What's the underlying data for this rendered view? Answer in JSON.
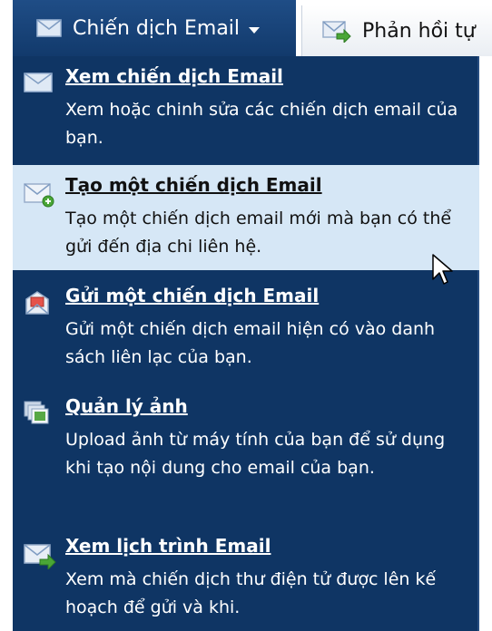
{
  "tabs": [
    {
      "label": "Chiến dịch Email",
      "icon": "envelope-icon"
    },
    {
      "label": "Phản hồi tự",
      "icon": "envelope-arrow-icon"
    }
  ],
  "menu": {
    "items": [
      {
        "title": "Xem chiến dịch Email",
        "desc": "Xem hoặc chinh sửa các chiến dịch email của bạn.",
        "icon": "envelope-icon"
      },
      {
        "title": "Tạo một chiến dịch Email",
        "desc": "Tạo một chiến dịch email mới mà bạn có thể gửi đến địa chi liên hệ.",
        "icon": "envelope-add-icon"
      },
      {
        "title": "Gửi một chiến dịch Email",
        "desc": "Gửi một chiến dịch email hiện có vào danh sách liên lạc của bạn.",
        "icon": "email-send-icon"
      },
      {
        "title": "Quản lý ảnh",
        "desc": "Upload ảnh từ máy tính của bạn để sử dụng khi tạo nội dung cho email của bạn.",
        "icon": "images-icon"
      },
      {
        "title": "Xem lịch trình Email",
        "desc": "Xem mà chiến dịch thư điện tử được lên kế hoạch để gửi và khi.",
        "icon": "envelope-arrow-icon"
      }
    ]
  },
  "colors": {
    "menu_bg": "#0f3564",
    "hover_bg": "#d6e7f6",
    "tab_active": "#1f4d86"
  }
}
